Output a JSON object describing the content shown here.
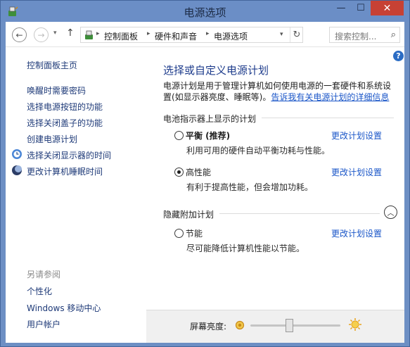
{
  "window": {
    "title": "电源选项",
    "minimize": "—",
    "maximize": "☐",
    "close": "✕"
  },
  "navigation": {
    "back": "←",
    "forward": "→",
    "recent": "▾",
    "up": "↑",
    "breadcrumb": [
      "控制面板",
      "硬件和声音",
      "电源选项"
    ],
    "separator": "▸",
    "dropdown": "▾",
    "refresh": "↻",
    "search_placeholder": "搜索控制...",
    "search_glyph": "⌕"
  },
  "sidebar": {
    "home": "控制面板主页",
    "links": [
      "唤醒时需要密码",
      "选择电源按钮的功能",
      "选择关闭盖子的功能",
      "创建电源计划",
      "选择关闭显示器的时间",
      "更改计算机睡眠时间"
    ],
    "see_also": "另请参阅",
    "see_also_links": [
      "个性化",
      "Windows 移动中心",
      "用户帐户"
    ]
  },
  "main": {
    "help": "?",
    "title": "选择或自定义电源计划",
    "desc_line1": "电源计划是用于管理计算机如何使用电源的一套硬件和系统设",
    "desc_line2_prefix": "置(如显示器亮度、睡眠等)。",
    "desc_link": "告诉我有关电源计划的详细信息",
    "battery_group": "电池指示器上显示的计划",
    "hidden_group": "隐藏附加计划",
    "collapse": "︿",
    "plans": [
      {
        "name": "平衡 (推荐)",
        "desc": "利用可用的硬件自动平衡功耗与性能。",
        "link": "更改计划设置",
        "selected": false
      },
      {
        "name": "高性能",
        "desc": "有利于提高性能，但会增加功耗。",
        "link": "更改计划设置",
        "selected": true
      },
      {
        "name": "节能",
        "desc": "尽可能降低计算机性能以节能。",
        "link": "更改计划设置",
        "selected": false
      }
    ]
  },
  "brightness": {
    "label": "屏幕亮度:",
    "level_percent": 43,
    "colors": {
      "sun": "#e8a21a"
    }
  }
}
